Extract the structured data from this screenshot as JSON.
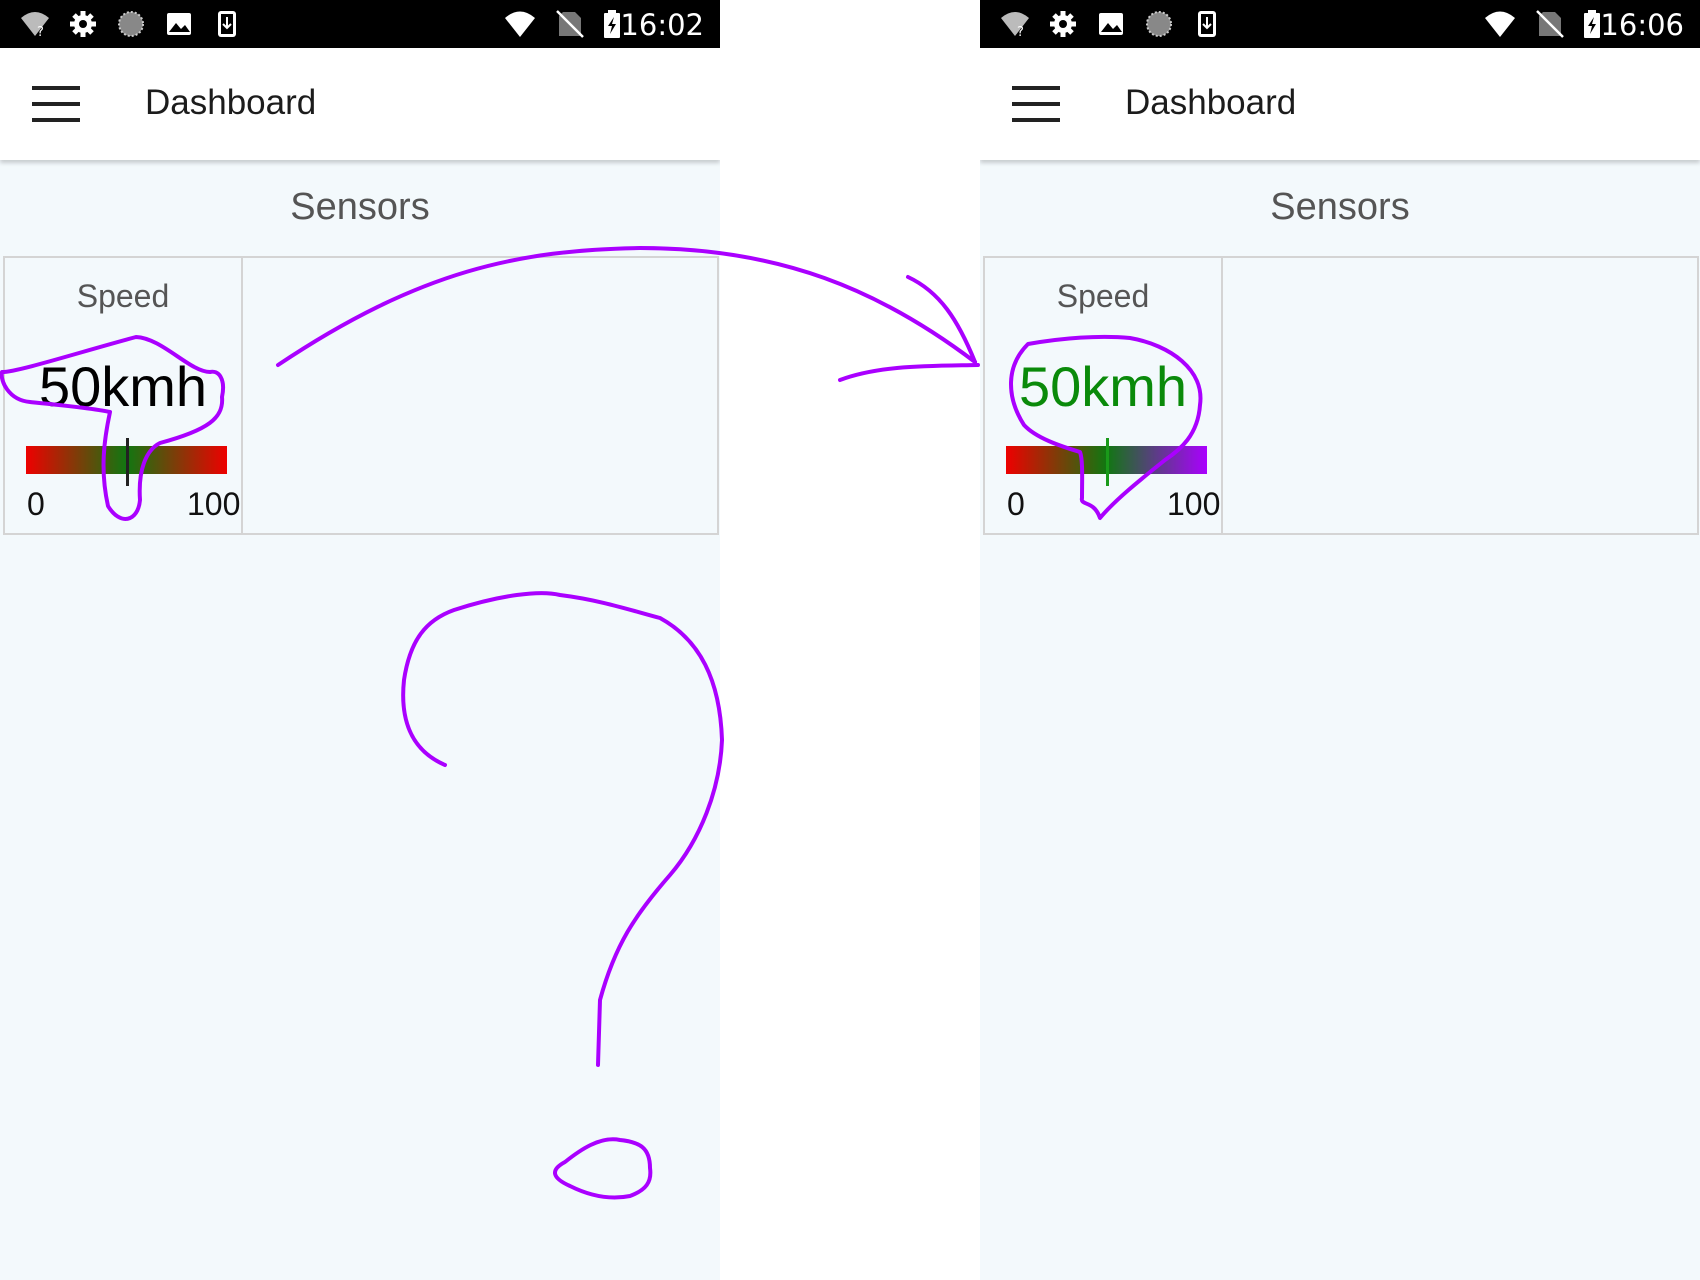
{
  "colors": {
    "annotation": "#aa00ff",
    "gauge_red": "#ee0000",
    "gauge_green": "#117711",
    "gauge_purple": "#aa00ff",
    "value_left": "#000000",
    "value_right": "#0a8a0a",
    "marker_left": "#222222",
    "marker_right": "#1a9a1a"
  },
  "screens": [
    {
      "status_bar": {
        "icons": [
          "wifi-question-icon",
          "settings-icon",
          "sync-icon",
          "image-icon",
          "download-icon",
          "wifi-icon",
          "no-sim-icon",
          "battery-charging-icon"
        ],
        "time": "16:02"
      },
      "app_bar": {
        "menu_icon": "hamburger-menu-icon",
        "title": "Dashboard"
      },
      "section_title": "Sensors",
      "sensor": {
        "label": "Speed",
        "value": "50kmh",
        "min_label": "0",
        "max_label": "100",
        "gauge_fraction": 0.5,
        "gauge_colors": [
          "#ee0000",
          "#117711",
          "#ee0000"
        ]
      }
    },
    {
      "status_bar": {
        "icons": [
          "wifi-question-icon",
          "settings-icon",
          "image-icon",
          "sync-icon",
          "download-icon",
          "wifi-icon",
          "no-sim-icon",
          "battery-charging-icon"
        ],
        "time": "16:06"
      },
      "app_bar": {
        "menu_icon": "hamburger-menu-icon",
        "title": "Dashboard"
      },
      "section_title": "Sensors",
      "sensor": {
        "label": "Speed",
        "value": "50kmh",
        "min_label": "0",
        "max_label": "100",
        "gauge_fraction": 0.5,
        "gauge_colors": [
          "#ee0000",
          "#117711",
          "#aa00ff"
        ]
      }
    }
  ],
  "annotations": [
    "curved-arrow",
    "question-mark",
    "circled-value-left",
    "circled-value-right"
  ]
}
